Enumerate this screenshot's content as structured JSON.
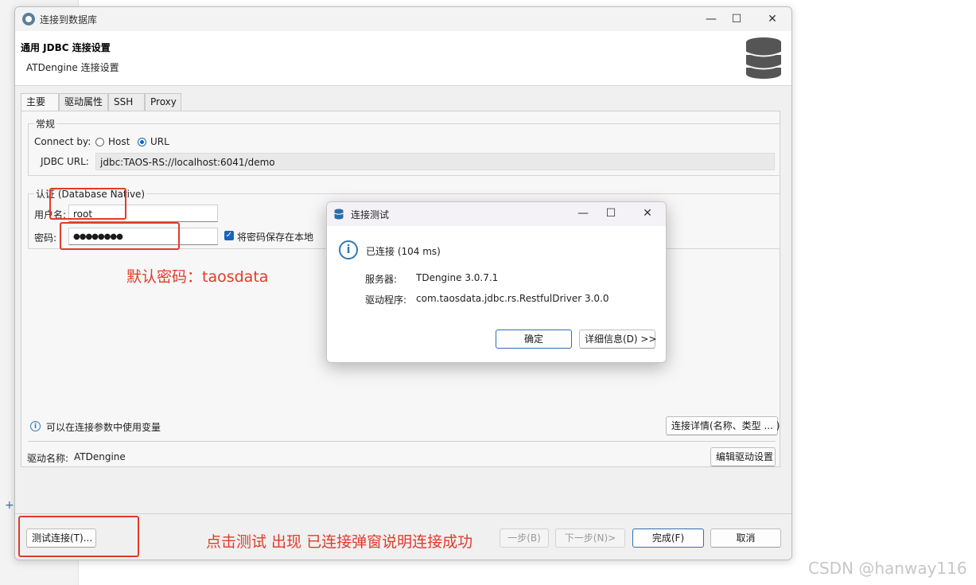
{
  "window": {
    "title": "连接到数据库",
    "controls": [
      "minimize",
      "maximize",
      "close"
    ]
  },
  "header": {
    "title": "通用 JDBC 连接设置",
    "subtitle": "ATDengine 连接设置",
    "icon": "database-icon"
  },
  "tabs": [
    {
      "label": "主要",
      "active": true
    },
    {
      "label": "驱动属性",
      "active": false
    },
    {
      "label": "SSH",
      "active": false
    },
    {
      "label": "Proxy",
      "active": false
    }
  ],
  "general": {
    "group_label": "常规",
    "connect_by_label": "Connect by:",
    "option_host": "Host",
    "option_url": "URL",
    "selected": "URL",
    "jdbc_url_label": "JDBC URL:",
    "jdbc_url_value": "jdbc:TAOS-RS://localhost:6041/demo"
  },
  "auth": {
    "group_label": "认证 (Database Native)",
    "username_label": "用户名:",
    "username_value": "root",
    "password_label": "密码:",
    "password_value": "●●●●●●●●",
    "save_password_label": "将密码保存在本地",
    "save_password_checked": true
  },
  "annotations": {
    "default_password": "默认密码：taosdata",
    "success_note": "点击测试  出现 已连接弹窗说明连接成功"
  },
  "hint": {
    "variables_text": "可以在连接参数中使用变量",
    "connection_details_button": "连接详情(名称、类型 ... )"
  },
  "driver": {
    "name_label": "驱动名称:",
    "name_value": "ATDengine",
    "edit_button": "编辑驱动设置"
  },
  "footer": {
    "test_button": "测试连接(T)...",
    "prev_button": "一步(B)",
    "next_button": "下一步(N)>",
    "finish_button": "完成(F)",
    "cancel_button": "取消"
  },
  "dialog": {
    "title": "连接测试",
    "status": "已连接 (104 ms)",
    "server_label": "服务器:",
    "server_value": "TDengine 3.0.7.1",
    "driver_label": "驱动程序:",
    "driver_value": "com.taosdata.jdbc.rs.RestfulDriver 3.0.0",
    "ok_button": "确定",
    "details_button": "详细信息(D) >>"
  },
  "watermark": "CSDN @hanway116",
  "colors": {
    "accent": "#1565c0",
    "annotation": "#e23a2a",
    "info": "#2a7ab8"
  }
}
